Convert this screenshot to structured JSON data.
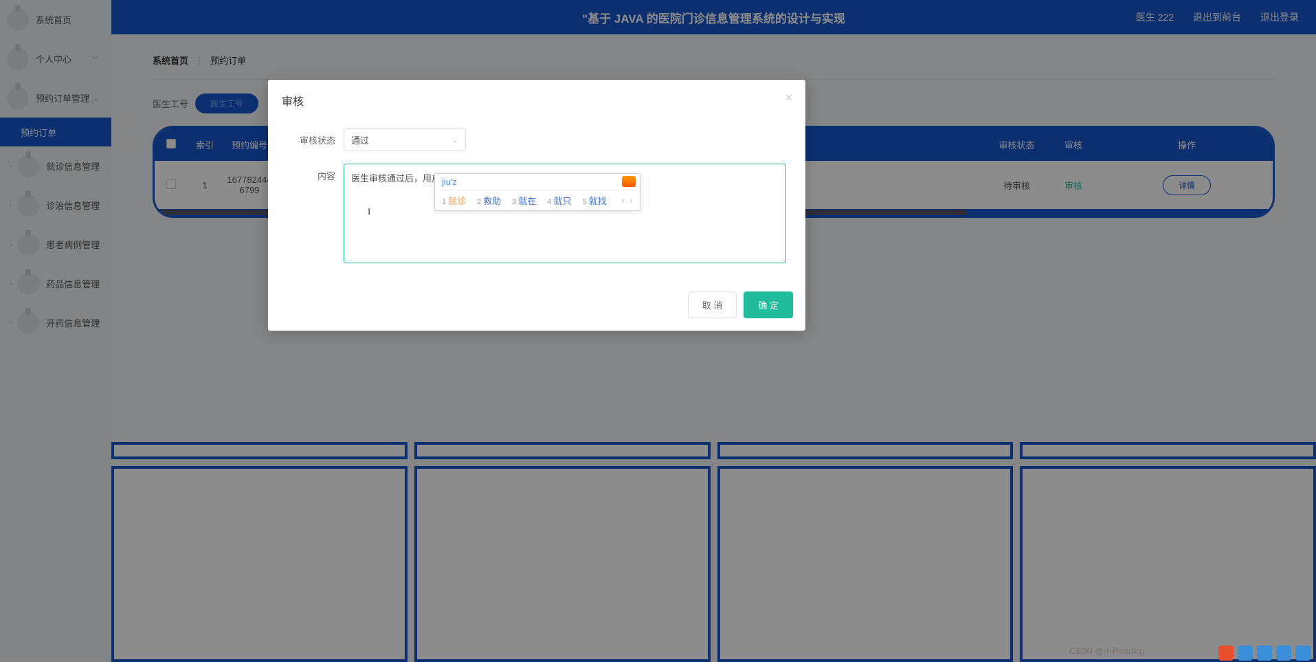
{
  "header": {
    "title": "\"基于 JAVA 的医院门诊信息管理系统的设计与实现",
    "user": "医生 222",
    "back_to_front": "退出到前台",
    "logout": "退出登录"
  },
  "sidebar": {
    "items": [
      {
        "label": "系统首页",
        "chev": ""
      },
      {
        "label": "个人中心",
        "chev": "﹀"
      },
      {
        "label": "预约订单管理",
        "chev": "︿"
      },
      {
        "label": "预约订单",
        "sub": true
      },
      {
        "label": "就诊信息管理",
        "chev": "﹀"
      },
      {
        "label": "诊治信息管理",
        "chev": "﹀"
      },
      {
        "label": "患者病例管理",
        "chev": "﹀"
      },
      {
        "label": "药品信息管理",
        "chev": "﹀"
      },
      {
        "label": "开药信息管理",
        "chev": "﹀"
      }
    ]
  },
  "breadcrumb": {
    "home": "系统首页",
    "current": "预约订单"
  },
  "filter": {
    "label": "医生工号",
    "placeholder": "医生工号"
  },
  "table": {
    "headers": {
      "index": "索引",
      "order_no": "预约编号",
      "audit_status": "审核状态",
      "audit": "审核",
      "action": "操作"
    },
    "rows": [
      {
        "index": "1",
        "order_no": "1677824446799",
        "audit_status": "待审核",
        "audit": "审核",
        "detail": "详情"
      }
    ]
  },
  "modal": {
    "title": "审核",
    "status_label": "审核状态",
    "status_value": "通过",
    "content_label": "内容",
    "content_value": "医生审核通过后，用户可按时jiuz",
    "cancel": "取 消",
    "confirm": "确 定"
  },
  "ime": {
    "input": "jiu'z",
    "candidates": [
      {
        "n": "1",
        "w": "就诊"
      },
      {
        "n": "2",
        "w": "救助"
      },
      {
        "n": "3",
        "w": "就在"
      },
      {
        "n": "4",
        "w": "就只"
      },
      {
        "n": "5",
        "w": "就找"
      }
    ]
  },
  "watermark": "CSDN @小孙coding"
}
